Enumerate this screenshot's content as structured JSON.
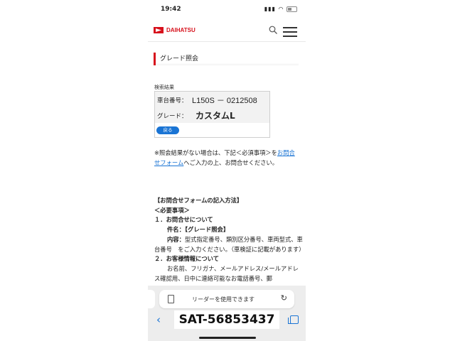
{
  "status": {
    "time": "19:42",
    "signal": "▮▮▮",
    "wifi": "◠"
  },
  "header": {
    "brand": "DAIHATSU"
  },
  "page": {
    "section_title": "グレード照会",
    "result_label": "検索結果",
    "rows": [
      {
        "label": "車台番号：",
        "value": "L150S － 0212508"
      },
      {
        "label": "グレード：",
        "value": "カスタムL"
      }
    ],
    "back_button": "戻る",
    "note_pre": "※照会結果がない場合は、下記＜必須事項＞を",
    "note_link": "お問合せフォーム",
    "note_post": "へご入力の上、お問合せください。",
    "howto_title": "【お問合せフォームの記入方法】",
    "howto_required": "＜必要事項＞",
    "item1_title": "１．お問合せについて",
    "item1_subject_label": "件名：",
    "item1_subject_value": "【グレード照会】",
    "item1_content_label": "内容：",
    "item1_content_value": "型式指定番号、類別区分番号、車両型式、車台番号　をご入力ください。（車検証に記載があります）",
    "item2_title": "２．お客様情報について",
    "item2_text": "お名前、フリガナ、メールアドレス/メールアドレス確認用、日中に連絡可能なお電話番号、郵"
  },
  "browser": {
    "reader_text": "リーダーを使用できます",
    "reload_icon": "↻",
    "back_icon": "‹"
  },
  "overlay": {
    "code": "SAT-56853437"
  },
  "colors": {
    "brand_red": "#d7111c",
    "link_blue": "#1a74d4"
  }
}
